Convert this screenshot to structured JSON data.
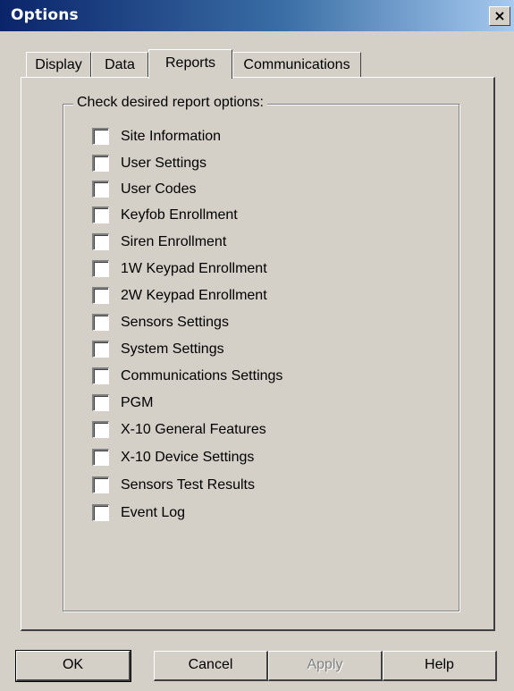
{
  "window": {
    "title": "Options",
    "close_glyph": "×"
  },
  "tabs": [
    {
      "label": "Display",
      "selected": false
    },
    {
      "label": "Data",
      "selected": false
    },
    {
      "label": "Reports",
      "selected": true
    },
    {
      "label": "Communications",
      "selected": false
    }
  ],
  "report_options": {
    "group_label": "Check desired report options:",
    "items": [
      {
        "label": "Site Information",
        "checked": false
      },
      {
        "label": "User Settings",
        "checked": false
      },
      {
        "label": "User Codes",
        "checked": false
      },
      {
        "label": "Keyfob Enrollment",
        "checked": false
      },
      {
        "label": "Siren Enrollment",
        "checked": false
      },
      {
        "label": "1W Keypad Enrollment",
        "checked": false
      },
      {
        "label": "2W Keypad Enrollment",
        "checked": false
      },
      {
        "label": "Sensors Settings",
        "checked": false
      },
      {
        "label": "System Settings",
        "checked": false
      },
      {
        "label": "Communications Settings",
        "checked": false
      },
      {
        "label": "PGM",
        "checked": false
      },
      {
        "label": "X-10 General Features",
        "checked": false
      },
      {
        "label": "X-10 Device Settings",
        "checked": false
      },
      {
        "label": "Sensors Test Results",
        "checked": false
      },
      {
        "label": "Event Log",
        "checked": false
      }
    ]
  },
  "buttons": {
    "ok": "OK",
    "cancel": "Cancel",
    "apply": "Apply",
    "apply_enabled": false,
    "help": "Help"
  }
}
